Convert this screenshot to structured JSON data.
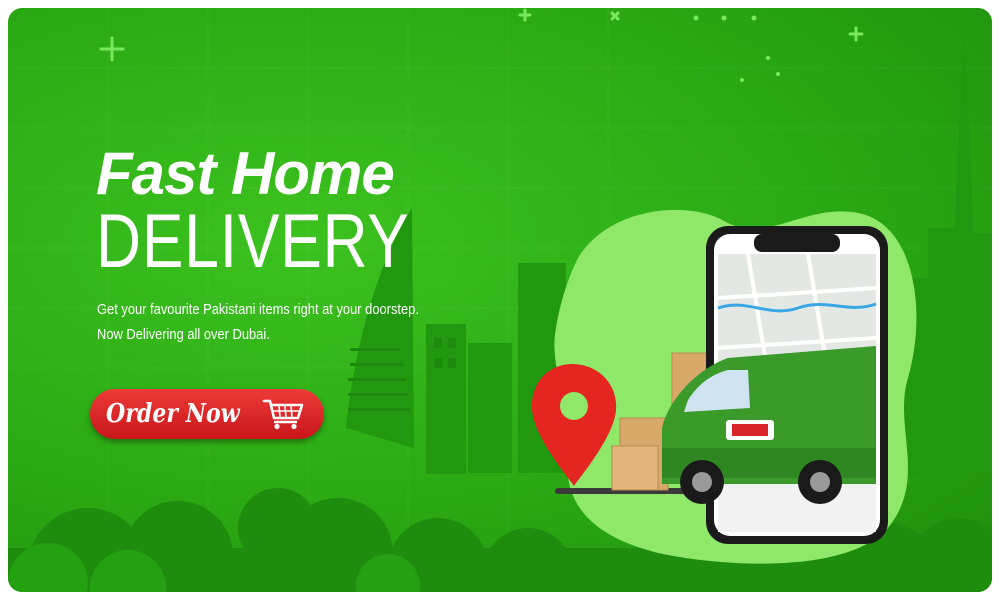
{
  "banner": {
    "headline_line1": "Fast Home",
    "headline_line2": "DELIVERY",
    "tagline_line1": "Get your favourite Pakistani items right at your doorstep.",
    "tagline_line2": "Now Delivering all over Dubai.",
    "cta_label": "Order Now",
    "cta_icon": "shopping-cart-icon"
  },
  "colors": {
    "background": "#2aa813",
    "button": "#d9232a",
    "pin": "#e52620",
    "van": "#3a9a2a",
    "box": "#d8a86a"
  }
}
